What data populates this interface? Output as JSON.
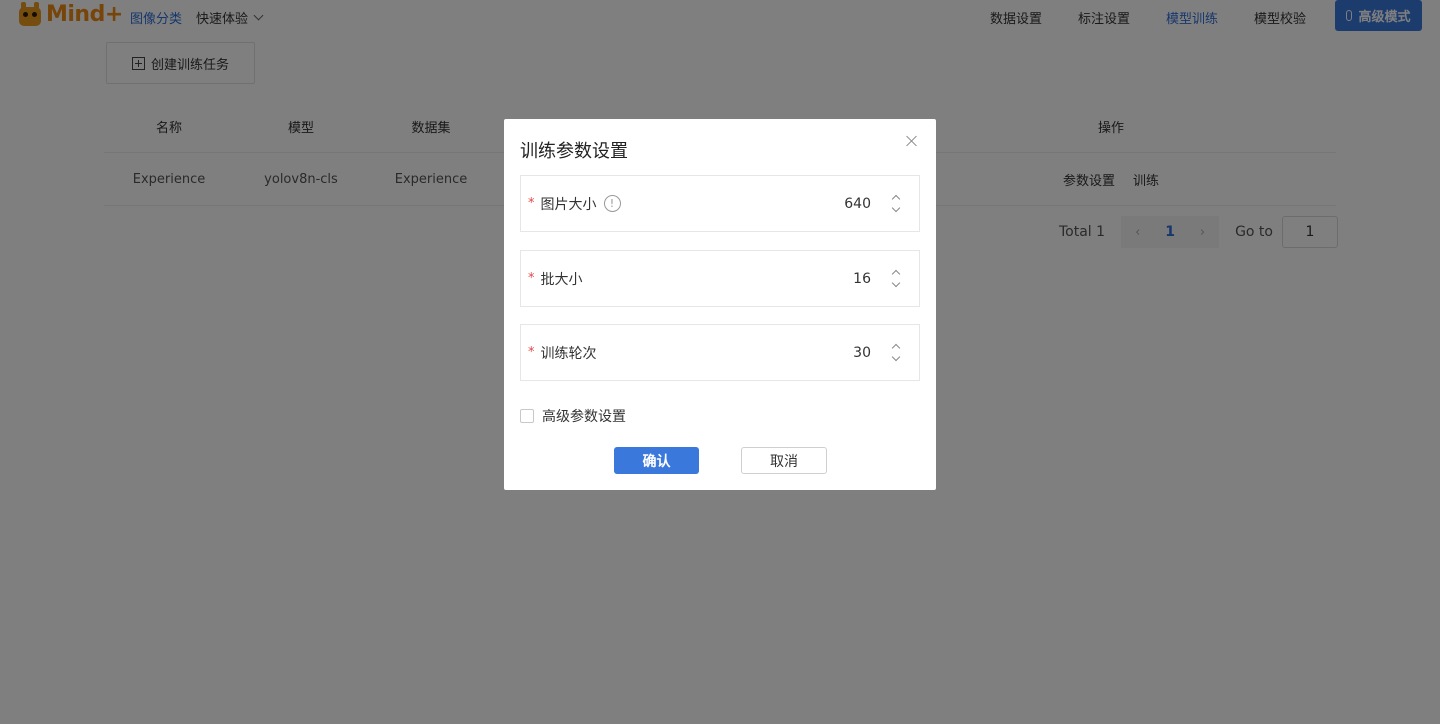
{
  "app": {
    "brand": "Mind+",
    "mode_label": "图像分类",
    "quick_label": "快速体验",
    "advanced_button": "高级模式",
    "accent_color": "#3a78dc"
  },
  "nav": {
    "items": [
      {
        "label": "数据设置",
        "active": false
      },
      {
        "label": "标注设置",
        "active": false
      },
      {
        "label": "模型训练",
        "active": true
      },
      {
        "label": "模型校验",
        "active": false
      }
    ]
  },
  "toolbar": {
    "create_label": "创建训练任务"
  },
  "table": {
    "headers": [
      "名称",
      "模型",
      "数据集",
      "操作"
    ],
    "rows": [
      {
        "name": "Experience",
        "model": "yolov8n-cls",
        "dataset": "Experience",
        "actions": [
          "参数设置",
          "训练"
        ]
      }
    ]
  },
  "pagination": {
    "total_label": "Total 1",
    "prev_icon": "‹",
    "current_page": "1",
    "next_icon": "›",
    "goto_label": "Go to",
    "goto_value": "1"
  },
  "dialog": {
    "title": "训练参数设置",
    "required_mark": "*",
    "info_glyph": "!",
    "fields": [
      {
        "label": "图片大小",
        "value": "640",
        "has_info": true
      },
      {
        "label": "批大小",
        "value": "16",
        "has_info": false
      },
      {
        "label": "训练轮次",
        "value": "30",
        "has_info": false
      }
    ],
    "advanced_checkbox_label": "高级参数设置",
    "confirm_label": "确认",
    "cancel_label": "取消"
  }
}
